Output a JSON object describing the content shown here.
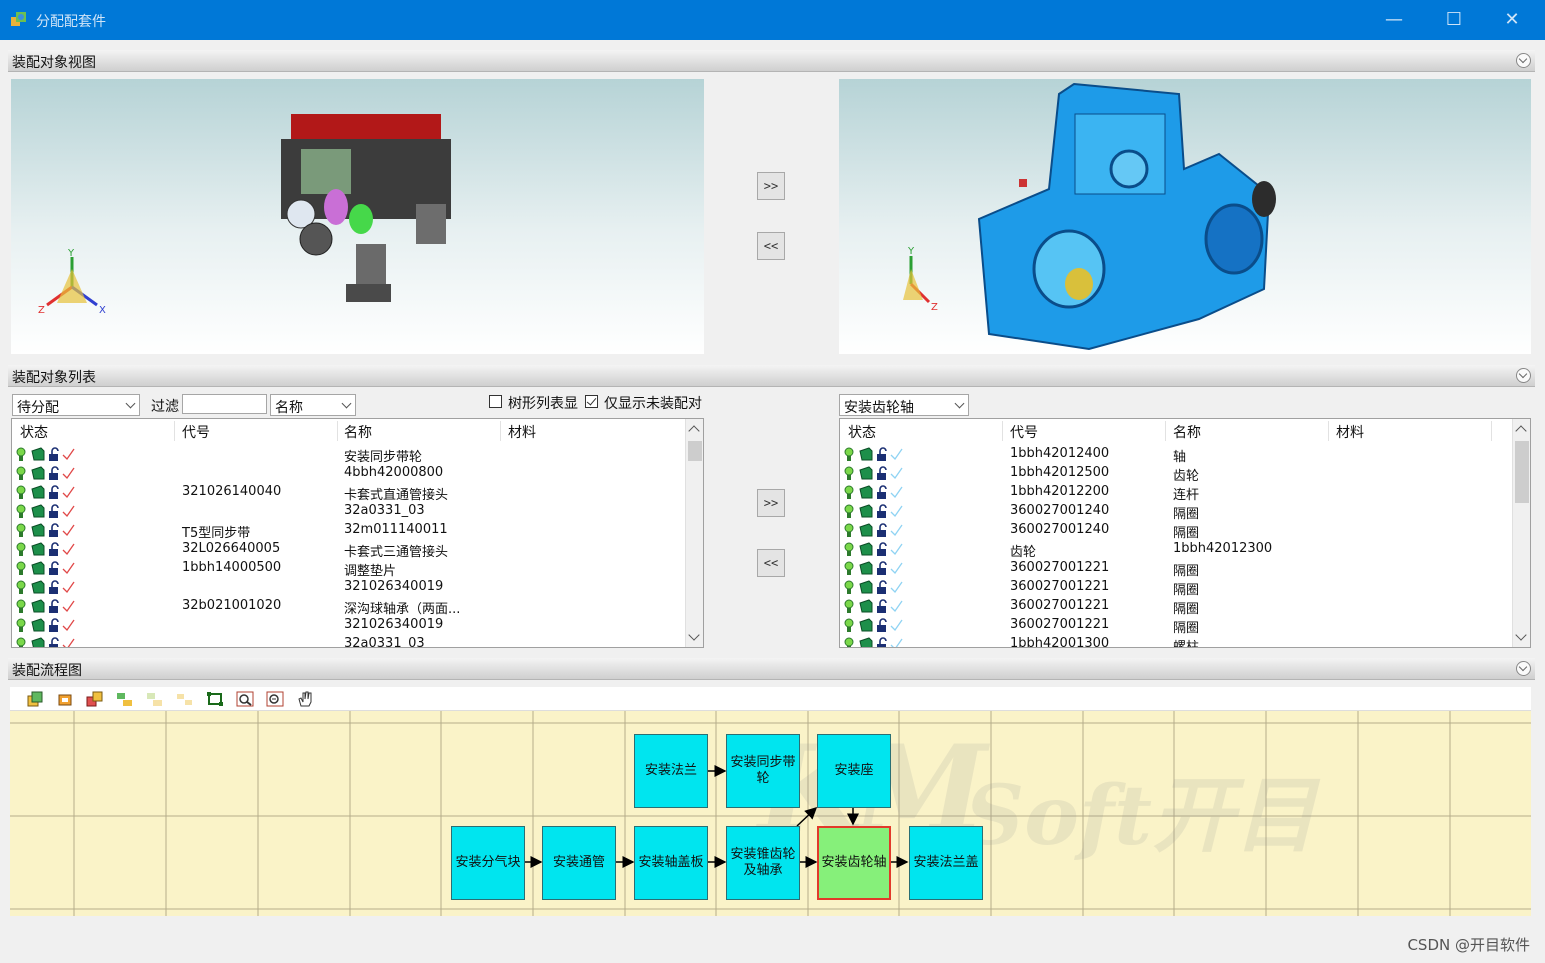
{
  "window": {
    "title": "分配配套件",
    "controls": {
      "minimize": "—",
      "maximize": "☐",
      "close": "✕"
    }
  },
  "sections": {
    "view": "装配对象视图",
    "list": "装配对象列表",
    "flow": "装配流程图"
  },
  "view": {
    "move_right": ">>",
    "move_left": "<<",
    "left_axes": {
      "x": "X",
      "y": "Y",
      "z": "Z"
    },
    "right_axes": {
      "y": "Y",
      "z": "Z"
    }
  },
  "left_list": {
    "status_combo": "待分配",
    "filter_label": "过滤",
    "filter_value": "",
    "filter_field_combo": "名称",
    "tree_checkbox_label": "树形列表显",
    "tree_checked": false,
    "unassigned_checkbox_label": "仅显示未装配对",
    "unassigned_checked": true,
    "columns": [
      "状态",
      "代号",
      "名称",
      "材料"
    ],
    "rows": [
      {
        "code": "",
        "name": "安装同步带轮"
      },
      {
        "code": "",
        "name": "4bbh42000800"
      },
      {
        "code": "321026140040",
        "name": "卡套式直通管接头"
      },
      {
        "code": "",
        "name": "32a0331_03"
      },
      {
        "code": "T5型同步带",
        "name": "32m011140011"
      },
      {
        "code": "32L026640005",
        "name": "卡套式三通管接头"
      },
      {
        "code": "1bbh14000500",
        "name": "调整垫片"
      },
      {
        "code": "",
        "name": "321026340019"
      },
      {
        "code": "32b021001020",
        "name": "深沟球轴承（两面..."
      },
      {
        "code": "",
        "name": "321026340019"
      },
      {
        "code": "",
        "name": "32a0331_03"
      }
    ]
  },
  "middle": {
    "move_right": ">>",
    "move_left": "<<"
  },
  "right_list": {
    "step_combo": "安装齿轮轴",
    "columns": [
      "状态",
      "代号",
      "名称",
      "材料"
    ],
    "rows": [
      {
        "code": "1bbh42012400",
        "name": "轴"
      },
      {
        "code": "1bbh42012500",
        "name": "齿轮"
      },
      {
        "code": "1bbh42012200",
        "name": "连杆"
      },
      {
        "code": "360027001240",
        "name": "隔圈"
      },
      {
        "code": "360027001240",
        "name": "隔圈"
      },
      {
        "code": "齿轮",
        "name": "1bbh42012300"
      },
      {
        "code": "360027001221",
        "name": "隔圈"
      },
      {
        "code": "360027001221",
        "name": "隔圈"
      },
      {
        "code": "360027001221",
        "name": "隔圈"
      },
      {
        "code": "360027001221",
        "name": "隔圈"
      },
      {
        "code": "1bbh42001300",
        "name": "螺柱"
      }
    ]
  },
  "flow": {
    "toolbar_icons": [
      "copy-icon",
      "group-icon",
      "ungroup-icon",
      "align-icon",
      "align-disabled-icon",
      "distribute-disabled-icon",
      "fit-icon",
      "zoom-in-icon",
      "zoom-out-icon",
      "pan-hand-icon"
    ],
    "nodes": {
      "flange": "安装法兰",
      "sync_wheel": "安装同步带轮",
      "seat": "安装座",
      "air_block": "安装分气块",
      "tube": "安装通管",
      "shaft_cover": "安装轴盖板",
      "bevel_gear": "安装锥齿轮及轴承",
      "gear_shaft": "安装齿轮轴",
      "flange_cover": "安装法兰盖"
    },
    "logo": {
      "mark": "KM",
      "text": "Soft开目"
    }
  },
  "watermark": "CSDN @开目软件",
  "colors": {
    "titlebar": "#0078d7",
    "node": "#00e5ef",
    "node_selected": "#86f07a",
    "selected_border": "#e23a2a",
    "flow_bg": "#faf3c8"
  }
}
